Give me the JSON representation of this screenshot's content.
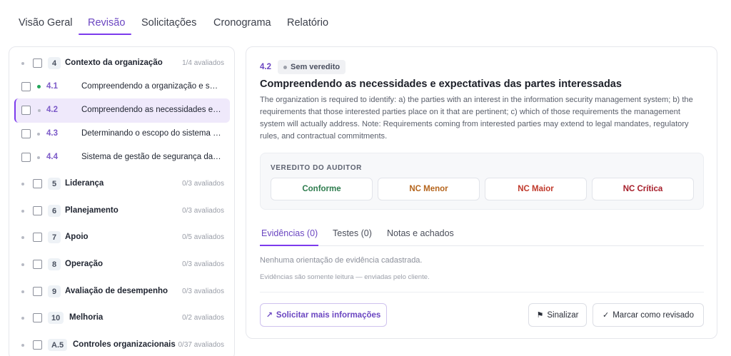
{
  "tabs": [
    {
      "label": "Visão Geral",
      "active": false
    },
    {
      "label": "Revisão",
      "active": true
    },
    {
      "label": "Solicitações",
      "active": false
    },
    {
      "label": "Cronograma",
      "active": false
    },
    {
      "label": "Relatório",
      "active": false
    }
  ],
  "tree": {
    "sections": [
      {
        "num": "4",
        "title": "Contexto da organização",
        "count": "1/4 avaliados",
        "expanded": true
      },
      {
        "num": "5",
        "title": "Liderança",
        "count": "0/3 avaliados"
      },
      {
        "num": "6",
        "title": "Planejamento",
        "count": "0/3 avaliados"
      },
      {
        "num": "7",
        "title": "Apoio",
        "count": "0/5 avaliados"
      },
      {
        "num": "8",
        "title": "Operação",
        "count": "0/3 avaliados"
      },
      {
        "num": "9",
        "title": "Avaliação de desempenho",
        "count": "0/3 avaliados"
      },
      {
        "num": "10",
        "title": "Melhoria",
        "count": "0/2 avaliados"
      },
      {
        "num": "A.5",
        "title": "Controles organizacionais",
        "count": "0/37 avaliados"
      }
    ],
    "subclauses": [
      {
        "num": "4.1",
        "title": "Compreendendo a organização e seu contexto",
        "status": "evaluated"
      },
      {
        "num": "4.2",
        "title": "Compreendendo as necessidades e expectativas das partes interessadas",
        "status": "pending",
        "selected": true
      },
      {
        "num": "4.3",
        "title": "Determinando o escopo do sistema de gestão",
        "status": "pending"
      },
      {
        "num": "4.4",
        "title": "Sistema de gestão de segurança da informação",
        "status": "pending"
      }
    ]
  },
  "detail": {
    "clause_id": "4.2",
    "verdict_badge": "Sem veredito",
    "title": "Compreendendo as necessidades e expectativas das partes interessadas",
    "description": "The organization is required to identify: a) the parties with an interest in the information security management system; b) the requirements that those interested parties place on it that are pertinent; c) which of those requirements the management system will actually address. Note: Requirements coming from interested parties may extend to legal mandates, regulatory rules, and contractual commitments.",
    "auditor_label": "VEREDITO DO AUDITOR",
    "verdict_buttons": [
      {
        "label": "Conforme",
        "color": "#2f7d4f"
      },
      {
        "label": "NC Menor",
        "color": "#b5651d"
      },
      {
        "label": "NC Maior",
        "color": "#c0392b"
      },
      {
        "label": "NC Crítica",
        "color": "#a61e2a"
      }
    ],
    "tabs": [
      {
        "label": "Evidências (0)",
        "active": true
      },
      {
        "label": "Testes (0)",
        "active": false
      },
      {
        "label": "Notas e achados",
        "active": false
      }
    ],
    "empty_message": "Nenhuma orientação de evidência cadastrada.",
    "readonly_message": "Evidências são somente leitura — enviadas pelo cliente.",
    "actions": {
      "request_info": "Solicitar mais informações",
      "flag": "Sinalizar",
      "mark_reviewed": "Marcar como revisado"
    }
  },
  "colors": {
    "accent": "#7c3aed",
    "selected_bg": "#efe9fb",
    "evaluated_dot": "#22a559"
  }
}
